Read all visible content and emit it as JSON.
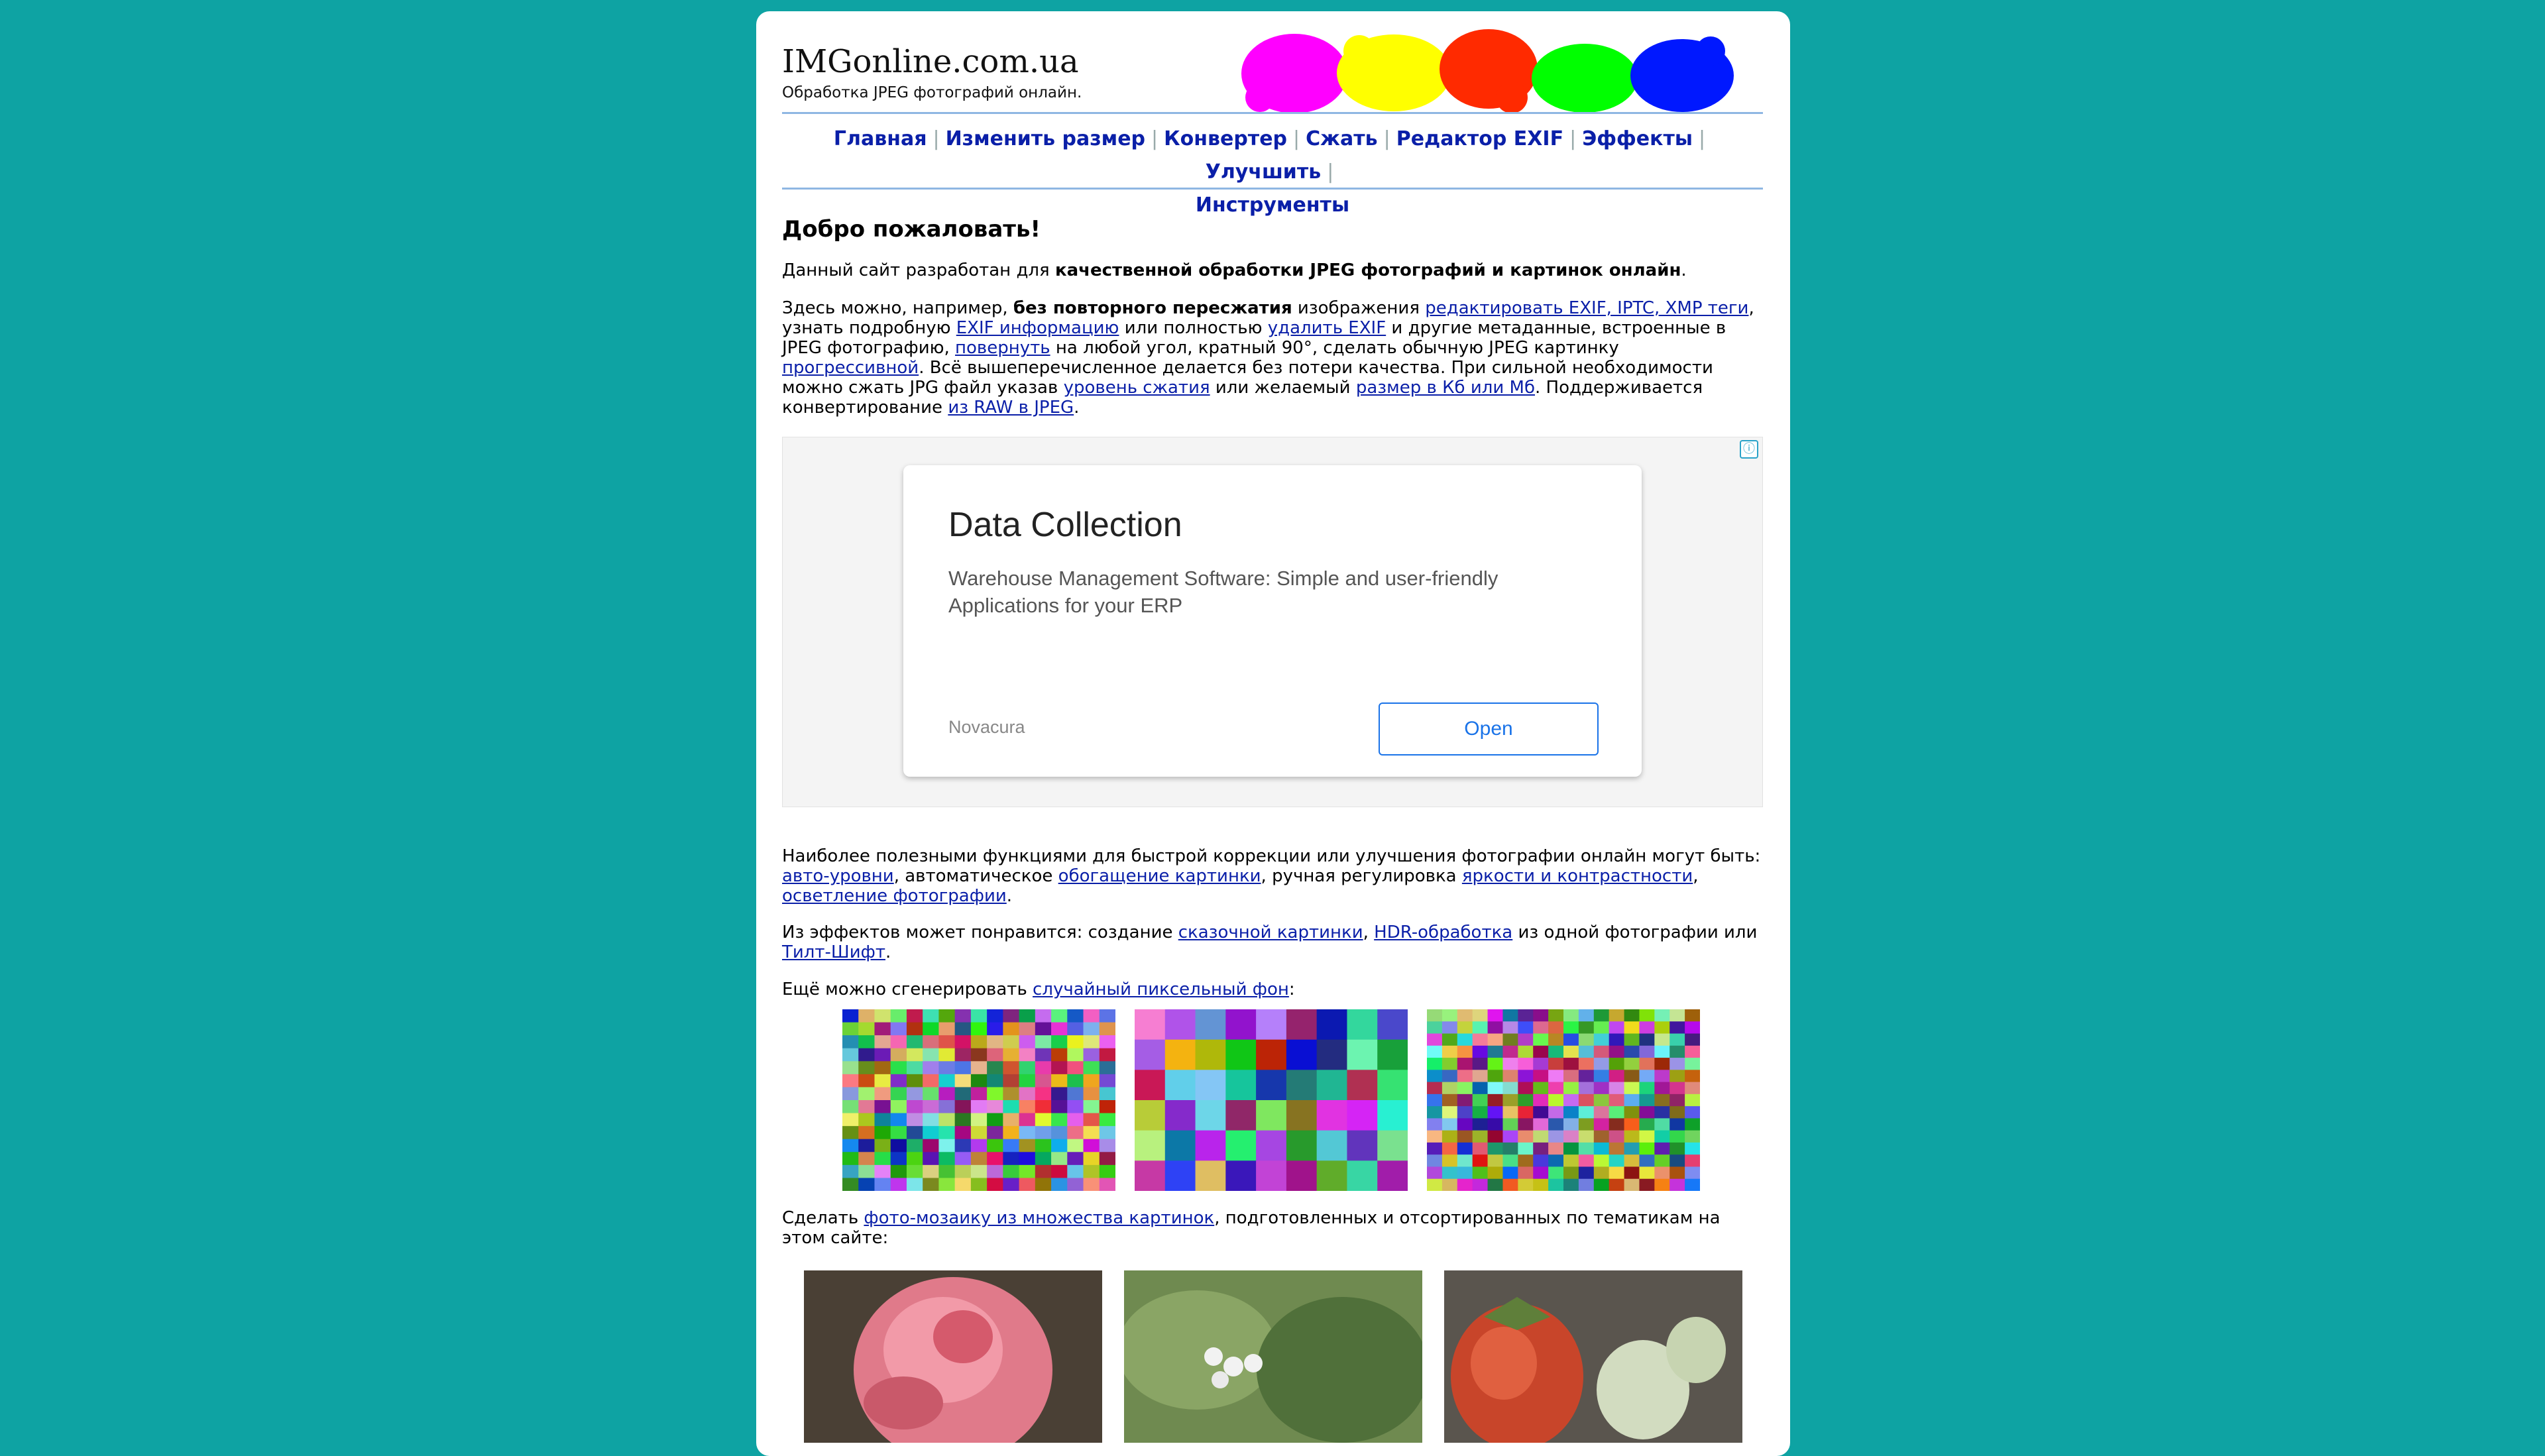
{
  "site": {
    "title": "IMGonline.com.ua",
    "subtitle": "Обработка JPEG фотографий онлайн."
  },
  "nav": {
    "items": [
      {
        "label": "Главная"
      },
      {
        "label": "Изменить размер"
      },
      {
        "label": "Конвертер"
      },
      {
        "label": "Сжать"
      },
      {
        "label": "Редактор EXIF"
      },
      {
        "label": "Эффекты"
      },
      {
        "label": "Улучшить"
      },
      {
        "label": "Инструменты"
      }
    ],
    "separator": "|"
  },
  "welcome": {
    "heading": "Добро пожаловать!",
    "intro_pre": "Данный сайт разработан для ",
    "intro_bold": "качественной обработки JPEG фотографий и картинок онлайн",
    "intro_post": "."
  },
  "features": {
    "t1": "Здесь можно, например, ",
    "b1": "без повторного пересжатия",
    "t2": " изображения ",
    "l1": "редактировать EXIF, IPTC, XMP теги",
    "t3": ", узнать подробную ",
    "l2": "EXIF информацию",
    "t4": " или полностью ",
    "l3": "удалить EXIF",
    "t5": " и другие метаданные, встроенные в JPEG фотографию, ",
    "l4": "повернуть",
    "t6": " на любой угол, кратный 90°, сделать обычную JPEG картинку ",
    "l5": "прогрессивной",
    "t7": ". Всё вышеперечисленное делается без потери качества. При сильной необходимости можно сжать JPG файл указав ",
    "l6": "уровень сжатия",
    "t8": " или желаемый ",
    "l7": "размер в Кб или Мб",
    "t9": ". Поддерживается конвертирование ",
    "l8": "из RAW в JPEG",
    "t10": "."
  },
  "ad": {
    "info_icon": "ⓘ",
    "title": "Data Collection",
    "description": "Warehouse Management Software: Simple and user-friendly Applications for your ERP",
    "brand": "Novacura",
    "button": "Open",
    "accent": "#1a73e8"
  },
  "useful": {
    "t1": "Наиболее полезными функциями для быстрой коррекции или улучшения фотографии онлайн могут быть: ",
    "l1": "авто-уровни",
    "t2": ", автоматическое ",
    "l2": "обогащение картинки",
    "t3": ", ручная регулировка ",
    "l3": "яркости и контрастности",
    "t4": ", ",
    "l4": "осветление фотографии",
    "t5": "."
  },
  "effects": {
    "t1": "Из эффектов может понравится: создание ",
    "l1": "сказочной картинки",
    "t2": ", ",
    "l2": "HDR-обработка",
    "t3": " из одной фотографии или ",
    "l3": "Тилт-Шифт",
    "t4": "."
  },
  "pixel": {
    "t1": "Ещё можно сгенерировать ",
    "l1": "случайный пиксельный фон",
    "t2": ":"
  },
  "mosaic": {
    "t1": "Сделать ",
    "l1": "фото-мозаику из множества картинок",
    "t2": ", подготовленных и отсортированных по тематикам на этом сайте:"
  },
  "colors": {
    "page_bg": "#0ea3a3",
    "link": "#0a1fa8",
    "rule": "#8fb7e3"
  }
}
